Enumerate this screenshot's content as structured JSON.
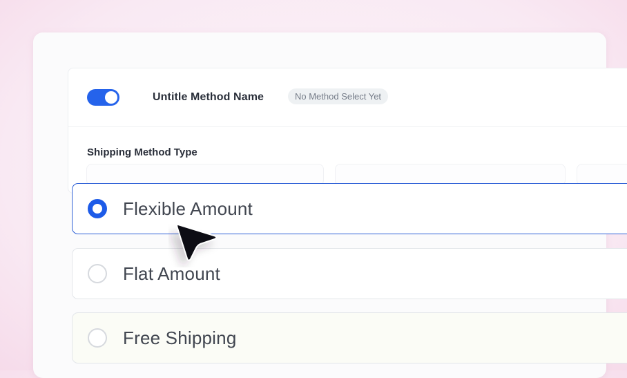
{
  "method": {
    "toggle_on": true,
    "name": "Untitle Method Name",
    "status_badge": "No Method Select Yet"
  },
  "shipping_method_type": {
    "label": "Shipping Method Type",
    "options": [
      {
        "label": "Flexible Amount",
        "selected": true
      },
      {
        "label": "Flat Amount",
        "selected": false
      },
      {
        "label": "Free Shipping",
        "selected": false
      }
    ]
  },
  "colors": {
    "accent": "#2563eb",
    "selected_border": "#2c5fd6",
    "text_primary": "#2a2f3a",
    "text_option": "#414650",
    "badge_bg": "#eef1f3",
    "badge_text": "#757c88",
    "background": "#f9e9f3"
  },
  "icons": {
    "cursor": "mouse-pointer-arrow-icon"
  }
}
